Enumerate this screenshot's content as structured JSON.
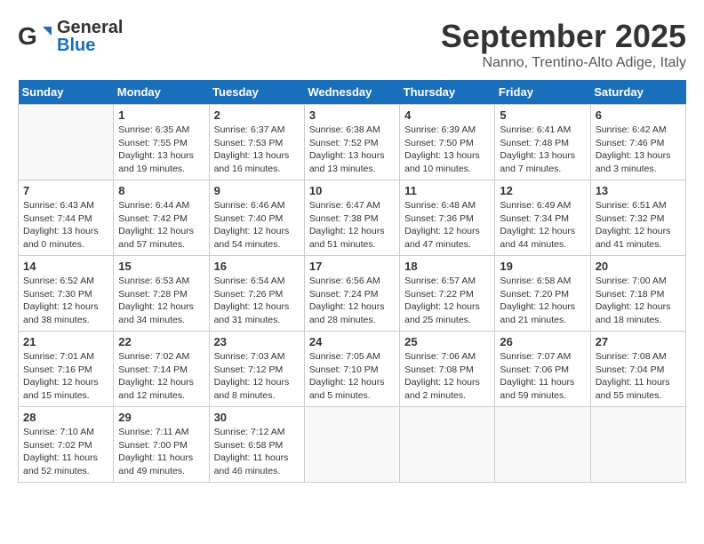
{
  "header": {
    "logo_general": "General",
    "logo_blue": "Blue",
    "month_title": "September 2025",
    "location": "Nanno, Trentino-Alto Adige, Italy"
  },
  "days_of_week": [
    "Sunday",
    "Monday",
    "Tuesday",
    "Wednesday",
    "Thursday",
    "Friday",
    "Saturday"
  ],
  "weeks": [
    [
      {
        "day": "",
        "info": ""
      },
      {
        "day": "1",
        "info": "Sunrise: 6:35 AM\nSunset: 7:55 PM\nDaylight: 13 hours\nand 19 minutes."
      },
      {
        "day": "2",
        "info": "Sunrise: 6:37 AM\nSunset: 7:53 PM\nDaylight: 13 hours\nand 16 minutes."
      },
      {
        "day": "3",
        "info": "Sunrise: 6:38 AM\nSunset: 7:52 PM\nDaylight: 13 hours\nand 13 minutes."
      },
      {
        "day": "4",
        "info": "Sunrise: 6:39 AM\nSunset: 7:50 PM\nDaylight: 13 hours\nand 10 minutes."
      },
      {
        "day": "5",
        "info": "Sunrise: 6:41 AM\nSunset: 7:48 PM\nDaylight: 13 hours\nand 7 minutes."
      },
      {
        "day": "6",
        "info": "Sunrise: 6:42 AM\nSunset: 7:46 PM\nDaylight: 13 hours\nand 3 minutes."
      }
    ],
    [
      {
        "day": "7",
        "info": "Sunrise: 6:43 AM\nSunset: 7:44 PM\nDaylight: 13 hours\nand 0 minutes."
      },
      {
        "day": "8",
        "info": "Sunrise: 6:44 AM\nSunset: 7:42 PM\nDaylight: 12 hours\nand 57 minutes."
      },
      {
        "day": "9",
        "info": "Sunrise: 6:46 AM\nSunset: 7:40 PM\nDaylight: 12 hours\nand 54 minutes."
      },
      {
        "day": "10",
        "info": "Sunrise: 6:47 AM\nSunset: 7:38 PM\nDaylight: 12 hours\nand 51 minutes."
      },
      {
        "day": "11",
        "info": "Sunrise: 6:48 AM\nSunset: 7:36 PM\nDaylight: 12 hours\nand 47 minutes."
      },
      {
        "day": "12",
        "info": "Sunrise: 6:49 AM\nSunset: 7:34 PM\nDaylight: 12 hours\nand 44 minutes."
      },
      {
        "day": "13",
        "info": "Sunrise: 6:51 AM\nSunset: 7:32 PM\nDaylight: 12 hours\nand 41 minutes."
      }
    ],
    [
      {
        "day": "14",
        "info": "Sunrise: 6:52 AM\nSunset: 7:30 PM\nDaylight: 12 hours\nand 38 minutes."
      },
      {
        "day": "15",
        "info": "Sunrise: 6:53 AM\nSunset: 7:28 PM\nDaylight: 12 hours\nand 34 minutes."
      },
      {
        "day": "16",
        "info": "Sunrise: 6:54 AM\nSunset: 7:26 PM\nDaylight: 12 hours\nand 31 minutes."
      },
      {
        "day": "17",
        "info": "Sunrise: 6:56 AM\nSunset: 7:24 PM\nDaylight: 12 hours\nand 28 minutes."
      },
      {
        "day": "18",
        "info": "Sunrise: 6:57 AM\nSunset: 7:22 PM\nDaylight: 12 hours\nand 25 minutes."
      },
      {
        "day": "19",
        "info": "Sunrise: 6:58 AM\nSunset: 7:20 PM\nDaylight: 12 hours\nand 21 minutes."
      },
      {
        "day": "20",
        "info": "Sunrise: 7:00 AM\nSunset: 7:18 PM\nDaylight: 12 hours\nand 18 minutes."
      }
    ],
    [
      {
        "day": "21",
        "info": "Sunrise: 7:01 AM\nSunset: 7:16 PM\nDaylight: 12 hours\nand 15 minutes."
      },
      {
        "day": "22",
        "info": "Sunrise: 7:02 AM\nSunset: 7:14 PM\nDaylight: 12 hours\nand 12 minutes."
      },
      {
        "day": "23",
        "info": "Sunrise: 7:03 AM\nSunset: 7:12 PM\nDaylight: 12 hours\nand 8 minutes."
      },
      {
        "day": "24",
        "info": "Sunrise: 7:05 AM\nSunset: 7:10 PM\nDaylight: 12 hours\nand 5 minutes."
      },
      {
        "day": "25",
        "info": "Sunrise: 7:06 AM\nSunset: 7:08 PM\nDaylight: 12 hours\nand 2 minutes."
      },
      {
        "day": "26",
        "info": "Sunrise: 7:07 AM\nSunset: 7:06 PM\nDaylight: 11 hours\nand 59 minutes."
      },
      {
        "day": "27",
        "info": "Sunrise: 7:08 AM\nSunset: 7:04 PM\nDaylight: 11 hours\nand 55 minutes."
      }
    ],
    [
      {
        "day": "28",
        "info": "Sunrise: 7:10 AM\nSunset: 7:02 PM\nDaylight: 11 hours\nand 52 minutes."
      },
      {
        "day": "29",
        "info": "Sunrise: 7:11 AM\nSunset: 7:00 PM\nDaylight: 11 hours\nand 49 minutes."
      },
      {
        "day": "30",
        "info": "Sunrise: 7:12 AM\nSunset: 6:58 PM\nDaylight: 11 hours\nand 46 minutes."
      },
      {
        "day": "",
        "info": ""
      },
      {
        "day": "",
        "info": ""
      },
      {
        "day": "",
        "info": ""
      },
      {
        "day": "",
        "info": ""
      }
    ]
  ]
}
